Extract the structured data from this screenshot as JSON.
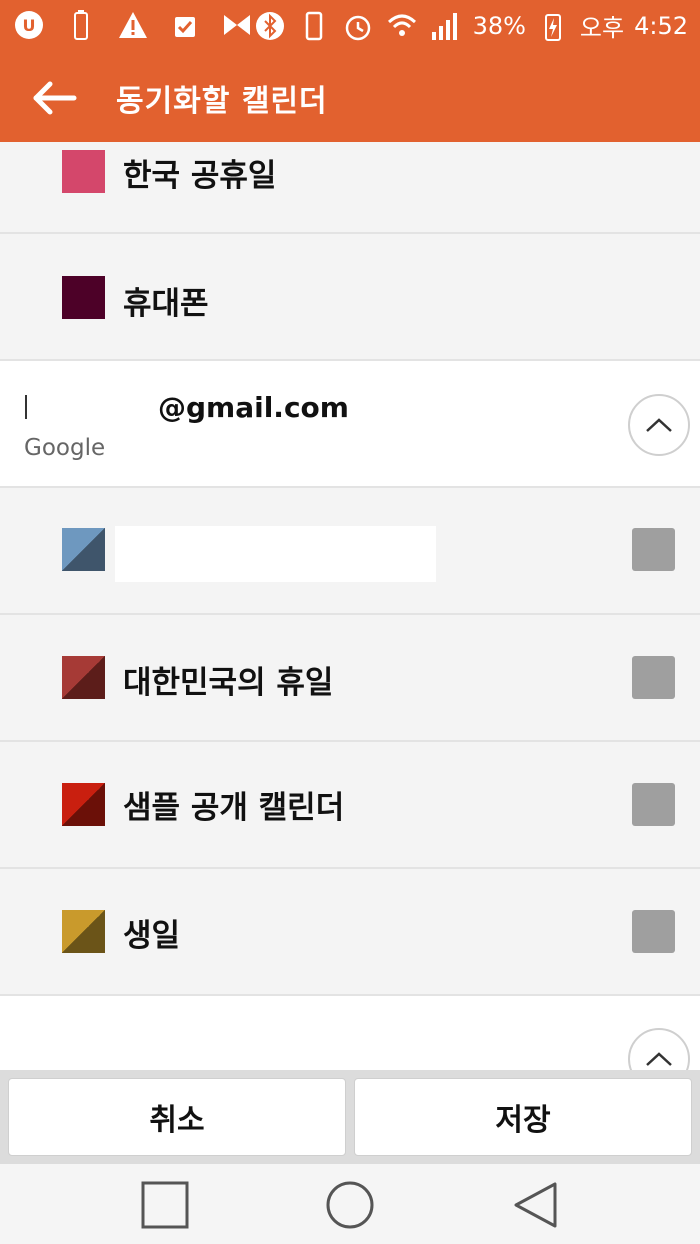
{
  "status_bar": {
    "battery_percent": "38%",
    "time_period": "오후",
    "time": "4:52"
  },
  "app_bar": {
    "title": "동기화할 캘린더"
  },
  "local_calendars": [
    {
      "label": "한국 공휴일",
      "color": "#d4476b"
    },
    {
      "label": "휴대폰",
      "color": "#4d0128"
    }
  ],
  "account": {
    "email": "@gmail.com",
    "provider": "Google"
  },
  "google_calendars": [
    {
      "label": "",
      "color": "#6e98bf",
      "corner_color": "#3f556b",
      "checked": false
    },
    {
      "label": "대한민국의 휴일",
      "color": "#a63a36",
      "corner_color": "#5c1d1a",
      "checked": false
    },
    {
      "label": "샘플 공개 캘린더",
      "color": "#c91f0f",
      "corner_color": "#6b1008",
      "checked": false
    },
    {
      "label": "생일",
      "color": "#c99a2c",
      "corner_color": "#6b5418",
      "checked": false
    }
  ],
  "buttons": {
    "cancel": "취소",
    "save": "저장"
  }
}
